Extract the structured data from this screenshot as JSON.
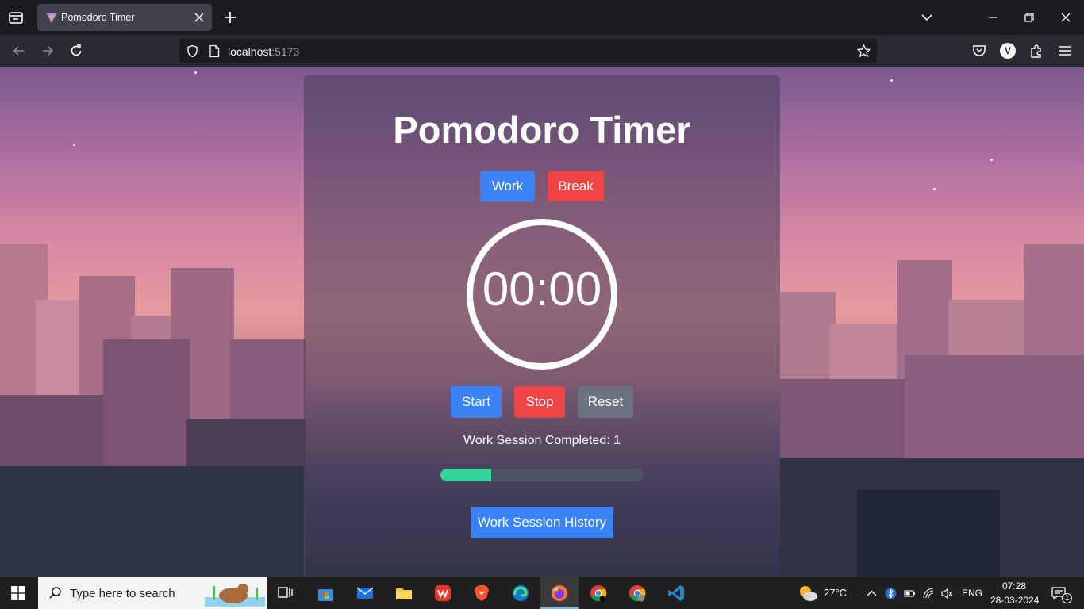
{
  "browser": {
    "tab_title": "Pomodoro Timer",
    "url_host": "localhost",
    "url_port": ":5173"
  },
  "app": {
    "title": "Pomodoro Timer",
    "mode_buttons": {
      "work": "Work",
      "break": "Break"
    },
    "timer_display": "00:00",
    "controls": {
      "start": "Start",
      "stop": "Stop",
      "reset": "Reset"
    },
    "sessions_completed": "Work Session Completed: 1",
    "progress_fraction": 0.25,
    "history_button": "Work Session History",
    "colors": {
      "primary": "#3b82f6",
      "danger": "#ef4444",
      "neutral": "#6b7280",
      "progress": "#34d399"
    }
  },
  "taskbar": {
    "search_placeholder": "Type here to search",
    "weather": "27°C",
    "language": "ENG",
    "time": "07:28",
    "date": "28-03-2024",
    "notification_count": "1",
    "apps": [
      "task-view-icon",
      "microsoft-store-icon",
      "mail-icon",
      "file-explorer-icon",
      "wps-office-icon",
      "brave-icon",
      "edge-icon",
      "firefox-icon",
      "chrome-icon",
      "chrome-profile-icon",
      "vscode-icon"
    ]
  }
}
